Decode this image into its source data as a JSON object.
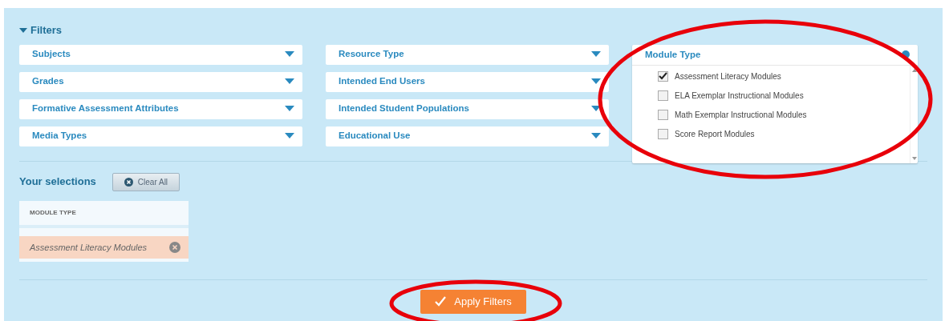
{
  "filters": {
    "title": "Filters",
    "expanded": true,
    "columns": [
      [
        {
          "label": "Subjects"
        },
        {
          "label": "Grades"
        },
        {
          "label": "Formative Assessment Attributes"
        },
        {
          "label": "Media Types"
        }
      ],
      [
        {
          "label": "Resource Type"
        },
        {
          "label": "Intended End Users"
        },
        {
          "label": "Intended Student Populations"
        },
        {
          "label": "Educational Use"
        }
      ]
    ],
    "module_type": {
      "title": "Module Type",
      "highlighted": true,
      "options": [
        {
          "label": "Assessment Literacy Modules",
          "checked": true
        },
        {
          "label": "ELA Exemplar Instructional Modules",
          "checked": false
        },
        {
          "label": "Math Exemplar Instructional Modules",
          "checked": false
        },
        {
          "label": "Score Report Modules",
          "checked": false
        }
      ]
    }
  },
  "selections": {
    "title": "Your selections",
    "clear_button": "Clear All",
    "groups": [
      {
        "heading": "MODULE TYPE",
        "items": [
          "Assessment Literacy Modules"
        ]
      }
    ]
  },
  "apply_button": {
    "label": "Apply Filters",
    "highlighted": true
  }
}
